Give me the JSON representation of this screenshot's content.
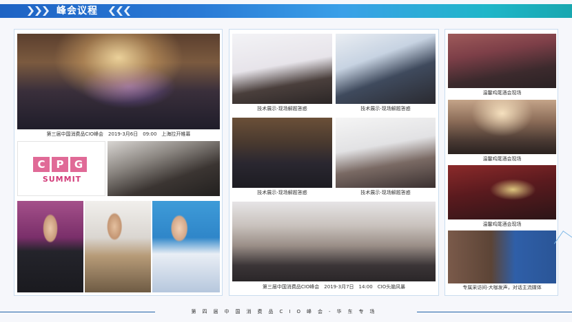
{
  "header": {
    "title": "峰会议程"
  },
  "left_panel": {
    "main_caption": "第三届中国消费品CIO峰会　2019-3月6日　09:00　上海拉开帷幕",
    "logo": {
      "letters": [
        "C",
        "P",
        "G"
      ],
      "subtitle": "SUMMIT"
    }
  },
  "middle_panel": {
    "captions": [
      "技术展示-现场解题答惑",
      "技术展示-现场解题答惑",
      "技术展示-现场解题答惑",
      "技术展示-现场解题答惑"
    ],
    "bottom_caption": "第三届中国消费品CIO峰会　2019-3月7日　14:00　CIO头脑风暴"
  },
  "right_panel": {
    "captions": [
      "温馨鸡尾酒会现场",
      "温馨鸡尾酒会现场",
      "温馨鸡尾酒会现场",
      "专属采访间-大咖发声，对话主流媒体"
    ]
  },
  "footer": {
    "text": "第四届中国消费品CIO峰会-华东专场"
  },
  "colors": {
    "brand_blue": "#1e63c4",
    "teal": "#18a7b0",
    "cpg_pink": "#e06a97"
  }
}
